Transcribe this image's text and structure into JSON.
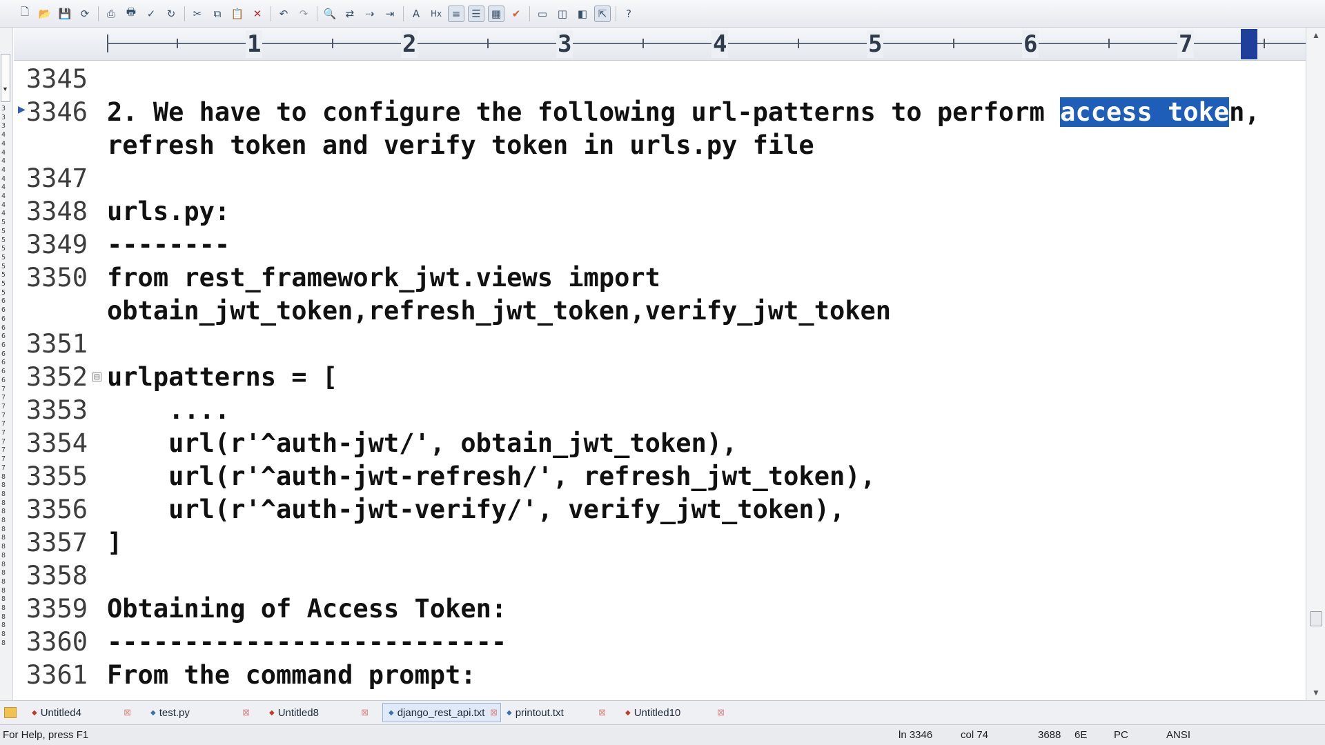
{
  "toolbar": {
    "buttons": [
      "new-file-icon",
      "open-folder-icon",
      "save-icon",
      "save-all-icon",
      "print-preview-icon",
      "print-icon",
      "spell-check-icon",
      "refresh-icon",
      "cut-icon",
      "copy-icon",
      "paste-icon",
      "delete-icon",
      "undo-icon",
      "redo-icon",
      "find-icon",
      "replace-icon",
      "goto-icon",
      "indent-icon",
      "font-icon",
      "hex-icon",
      "word-wrap-icon",
      "list-icon",
      "column-icon",
      "checkmark-icon",
      "window-icon",
      "split-icon",
      "compare-icon",
      "external-icon",
      "help-icon"
    ]
  },
  "ruler": {
    "numbers": [
      "1",
      "2",
      "3",
      "4",
      "5",
      "6",
      "7"
    ]
  },
  "editor": {
    "lines": [
      {
        "num": "3345",
        "text": ""
      },
      {
        "num": "3346",
        "pre": "2. We have to configure the following url-patterns to perform ",
        "sel": "access toke",
        "post": "n,",
        "cont": "refresh token and verify token in urls.py file"
      },
      {
        "num": "3347",
        "text": ""
      },
      {
        "num": "3348",
        "text": "urls.py:"
      },
      {
        "num": "3349",
        "text": "--------"
      },
      {
        "num": "3350",
        "text": "from rest_framework_jwt.views import",
        "cont": "obtain_jwt_token,refresh_jwt_token,verify_jwt_token"
      },
      {
        "num": "3351",
        "text": ""
      },
      {
        "num": "3352",
        "text": "urlpatterns = [",
        "fold": "⊟"
      },
      {
        "num": "3353",
        "text": "    ...."
      },
      {
        "num": "3354",
        "text": "    url(r'^auth-jwt/', obtain_jwt_token),"
      },
      {
        "num": "3355",
        "text": "    url(r'^auth-jwt-refresh/', refresh_jwt_token),"
      },
      {
        "num": "3356",
        "text": "    url(r'^auth-jwt-verify/', verify_jwt_token),"
      },
      {
        "num": "3357",
        "text": "]"
      },
      {
        "num": "3358",
        "text": ""
      },
      {
        "num": "3359",
        "text": "Obtaining of Access Token:"
      },
      {
        "num": "3360",
        "text": "--------------------------"
      },
      {
        "num": "3361",
        "text": "From the command prompt:"
      }
    ]
  },
  "tabs": [
    {
      "label": "Untitled4"
    },
    {
      "label": "test.py"
    },
    {
      "label": "Untitled8"
    },
    {
      "label": "django_rest_api.txt",
      "active": true
    },
    {
      "label": "printout.txt"
    },
    {
      "label": "Untitled10"
    }
  ],
  "status": {
    "help": "For Help, press F1",
    "line": "ln 3346",
    "col": "col 74",
    "count": "3688",
    "hex": "6E",
    "os": "PC",
    "encoding": "ANSI"
  }
}
